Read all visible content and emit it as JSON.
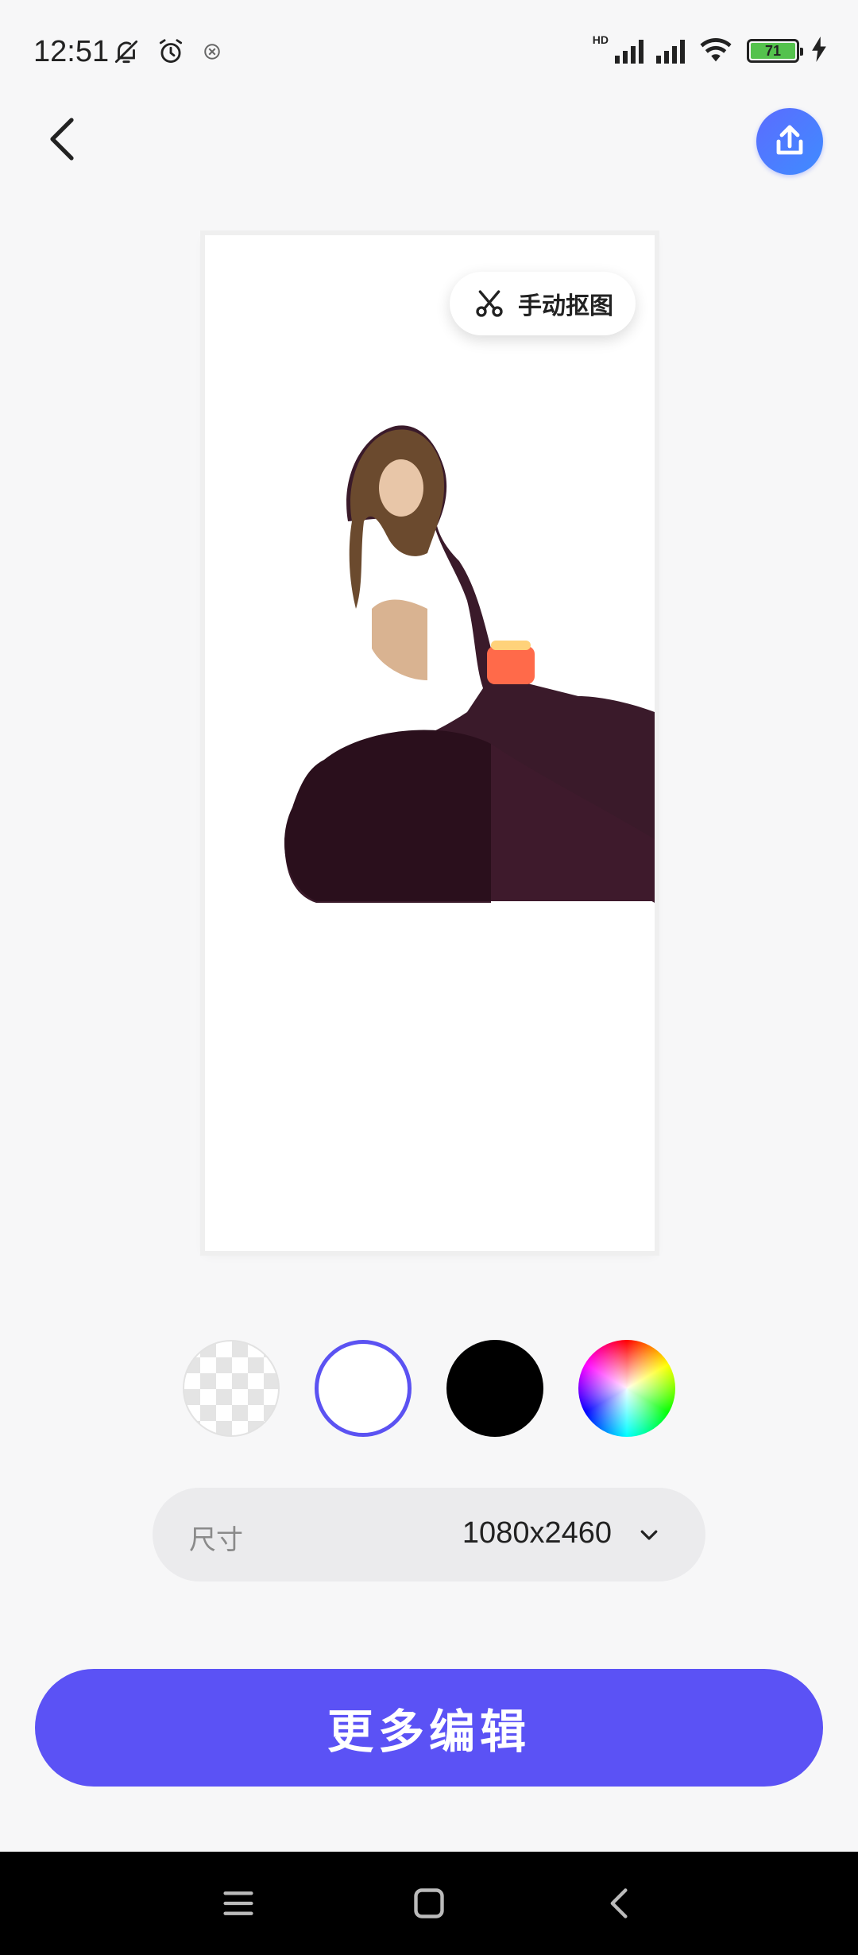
{
  "status_bar": {
    "time": "12:51",
    "network_label": "HD",
    "battery_level": "71",
    "icons": [
      "bell-off-icon",
      "alarm-icon",
      "app-notification-icon",
      "signal-icon",
      "signal-icon",
      "wifi-icon",
      "battery-icon",
      "charging-icon"
    ]
  },
  "toolbar": {
    "back_icon": "back-arrow-icon",
    "share_icon": "share-icon"
  },
  "preview": {
    "manual_cutout_label": "手动抠图",
    "manual_cutout_icon": "scissors-icon"
  },
  "background_options": [
    {
      "name": "transparent",
      "selected": false
    },
    {
      "name": "white",
      "selected": true,
      "color": "#ffffff"
    },
    {
      "name": "black",
      "selected": false,
      "color": "#000000"
    },
    {
      "name": "custom-color",
      "selected": false
    }
  ],
  "size_selector": {
    "label": "尺寸",
    "value": "1080x2460"
  },
  "primary_action": {
    "label": "更多编辑",
    "color": "#5b52f5"
  },
  "accent_color": "#5b52f2",
  "nav_bar": {
    "icons": [
      "menu-icon",
      "home-icon",
      "back-icon"
    ]
  }
}
